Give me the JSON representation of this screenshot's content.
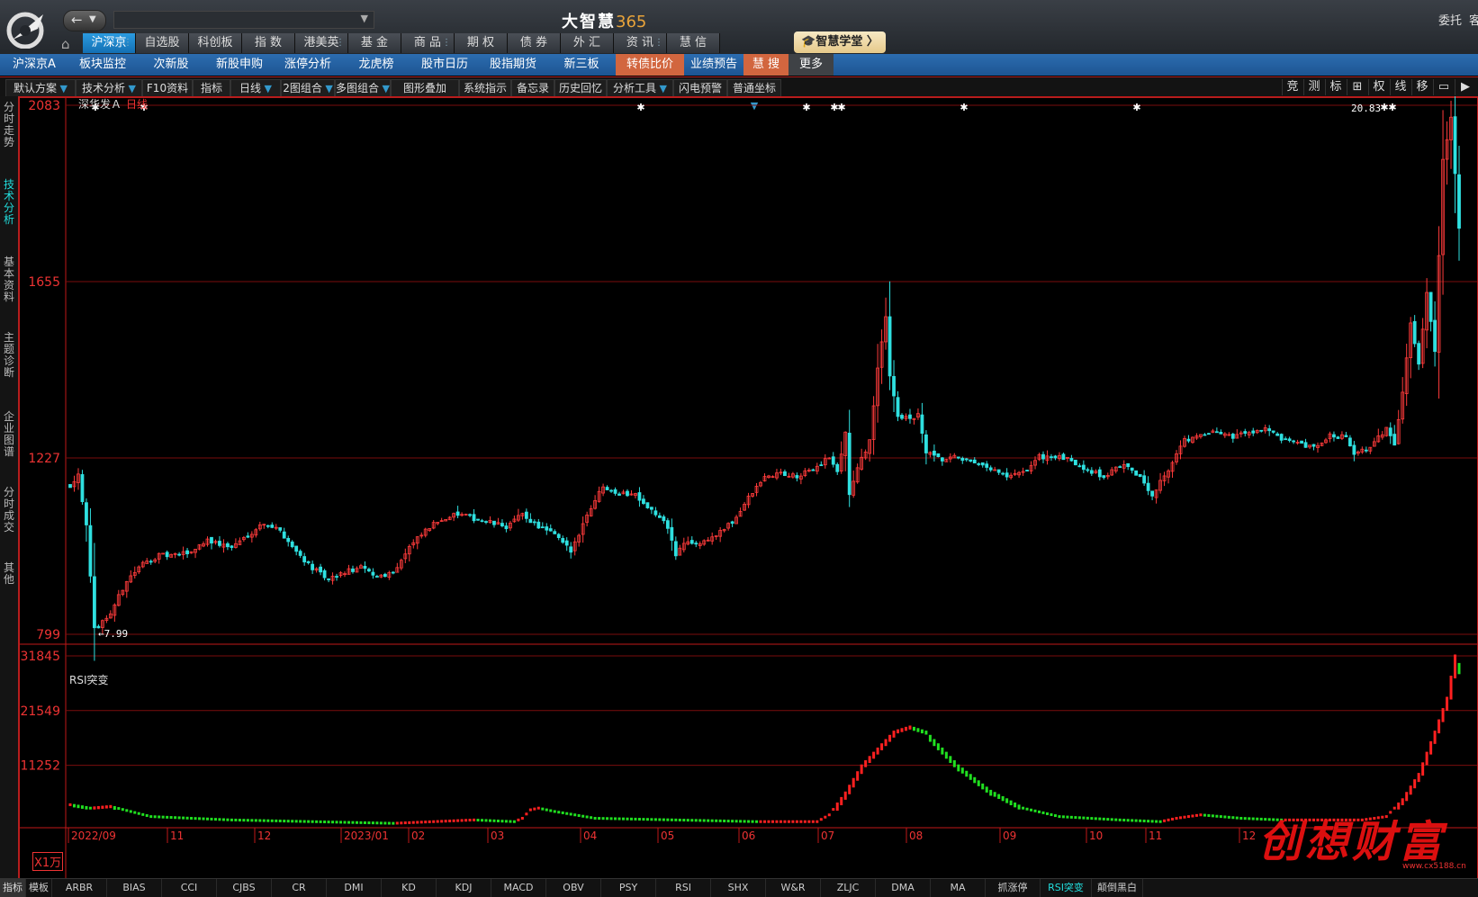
{
  "app": {
    "title_text": "大智慧",
    "title_num": "365",
    "entrust": "委托",
    "entrust2": "客"
  },
  "main_nav": [
    {
      "label": "沪深京",
      "active": true,
      "dots": true
    },
    {
      "label": "自选股",
      "active": false,
      "dots": false
    },
    {
      "label": "科创板",
      "active": false,
      "dots": false
    },
    {
      "label": "指 数",
      "active": false,
      "dots": false
    },
    {
      "label": "港美英",
      "active": false,
      "dots": true
    },
    {
      "label": "基 金",
      "active": false,
      "dots": false
    },
    {
      "label": "商 品",
      "active": false,
      "dots": true
    },
    {
      "label": "期 权",
      "active": false,
      "dots": false
    },
    {
      "label": "债 券",
      "active": false,
      "dots": false
    },
    {
      "label": "外 汇",
      "active": false,
      "dots": false
    },
    {
      "label": "资 讯",
      "active": false,
      "dots": true
    },
    {
      "label": "慧 信",
      "active": false,
      "dots": false
    }
  ],
  "academy_label": "智慧学堂",
  "menu2": [
    {
      "label": "沪深京A",
      "style": ""
    },
    {
      "label": "板块监控",
      "style": ""
    },
    {
      "label": "次新股",
      "style": ""
    },
    {
      "label": "新股申购",
      "style": ""
    },
    {
      "label": "涨停分析",
      "style": ""
    },
    {
      "label": "龙虎榜",
      "style": ""
    },
    {
      "label": "股市日历",
      "style": ""
    },
    {
      "label": "股指期货",
      "style": ""
    },
    {
      "label": "新三板",
      "style": ""
    },
    {
      "label": "转债比价",
      "style": "hot"
    },
    {
      "label": "业绩预告",
      "style": ""
    },
    {
      "label": "慧 搜",
      "style": "hot"
    },
    {
      "label": "更多",
      "style": "gray"
    }
  ],
  "toolbar": [
    {
      "label": "默认方案",
      "arrow": true
    },
    {
      "label": "技术分析",
      "arrow": true
    },
    {
      "label": "F10资料",
      "arrow": false
    },
    {
      "label": "指标",
      "arrow": false
    },
    {
      "label": "日线",
      "arrow": true
    },
    {
      "label": "2图组合",
      "arrow": true
    },
    {
      "label": "多图组合",
      "arrow": true
    },
    {
      "label": "图形叠加",
      "arrow": false
    },
    {
      "label": "系统指示",
      "arrow": false
    },
    {
      "label": "备忘录",
      "arrow": false
    },
    {
      "label": "历史回忆",
      "arrow": false
    },
    {
      "label": "分析工具",
      "arrow": true
    },
    {
      "label": "闪电预警",
      "arrow": false
    },
    {
      "label": "普通坐标",
      "arrow": true
    }
  ],
  "toolbar_right": [
    "竞",
    "测",
    "标",
    "⊞",
    "权",
    "线",
    "移",
    "▭",
    "▶"
  ],
  "left_tabs": [
    {
      "label": "分时走势",
      "active": false
    },
    {
      "label": "技术分析",
      "active": true
    },
    {
      "label": "基本资料",
      "active": false
    },
    {
      "label": "主题诊断",
      "active": false
    },
    {
      "label": "企业图谱",
      "active": false
    },
    {
      "label": "分时成交",
      "active": false
    },
    {
      "label": "其他",
      "active": false
    }
  ],
  "stock": {
    "name": "深华发Ａ",
    "period": "日线"
  },
  "chart_data": {
    "type": "candlestick",
    "price_axis": {
      "labels": [
        "2083",
        "1655",
        "1227",
        "799"
      ],
      "values": [
        20.83,
        16.55,
        12.27,
        7.99
      ]
    },
    "max_label": "20.83",
    "min_label": "7.99",
    "indicator": {
      "name": "RSI突变",
      "axis_labels": [
        "31845",
        "21549",
        "11252"
      ],
      "axis_values": [
        31845,
        21549,
        11252
      ],
      "unit_label": "X1万"
    },
    "x_labels": [
      "2022/09",
      "11",
      "12",
      "2023/01",
      "02",
      "03",
      "04",
      "05",
      "06",
      "07",
      "08",
      "09",
      "10",
      "11",
      "12"
    ],
    "price_anchors": [
      [
        0,
        11.6
      ],
      [
        2,
        11.9
      ],
      [
        4,
        10.6
      ],
      [
        6,
        8.1
      ],
      [
        10,
        8.5
      ],
      [
        14,
        9.3
      ],
      [
        18,
        9.7
      ],
      [
        22,
        9.9
      ],
      [
        26,
        9.9
      ],
      [
        30,
        10.0
      ],
      [
        34,
        10.3
      ],
      [
        36,
        10.2
      ],
      [
        40,
        10.1
      ],
      [
        44,
        10.4
      ],
      [
        48,
        10.7
      ],
      [
        52,
        10.5
      ],
      [
        56,
        10.0
      ],
      [
        60,
        9.6
      ],
      [
        64,
        9.3
      ],
      [
        68,
        9.5
      ],
      [
        72,
        9.6
      ],
      [
        76,
        9.4
      ],
      [
        80,
        9.5
      ],
      [
        84,
        10.1
      ],
      [
        88,
        10.5
      ],
      [
        92,
        10.8
      ],
      [
        96,
        10.9
      ],
      [
        100,
        10.8
      ],
      [
        104,
        10.7
      ],
      [
        108,
        10.6
      ],
      [
        112,
        10.9
      ],
      [
        116,
        10.6
      ],
      [
        120,
        10.4
      ],
      [
        124,
        10.0
      ],
      [
        128,
        10.9
      ],
      [
        132,
        11.6
      ],
      [
        136,
        11.4
      ],
      [
        140,
        11.4
      ],
      [
        144,
        11.0
      ],
      [
        148,
        10.6
      ],
      [
        150,
        9.9
      ],
      [
        152,
        10.2
      ],
      [
        156,
        10.2
      ],
      [
        160,
        10.4
      ],
      [
        164,
        10.7
      ],
      [
        168,
        11.3
      ],
      [
        172,
        11.8
      ],
      [
        176,
        11.9
      ],
      [
        180,
        11.8
      ],
      [
        184,
        12.0
      ],
      [
        188,
        12.3
      ],
      [
        190,
        11.9
      ],
      [
        192,
        12.9
      ],
      [
        193,
        11.4
      ],
      [
        195,
        12.0
      ],
      [
        198,
        12.7
      ],
      [
        200,
        14.4
      ],
      [
        202,
        15.7
      ],
      [
        203,
        14.3
      ],
      [
        205,
        13.3
      ],
      [
        208,
        13.2
      ],
      [
        210,
        13.3
      ],
      [
        212,
        12.4
      ],
      [
        216,
        12.2
      ],
      [
        220,
        12.3
      ],
      [
        224,
        12.1
      ],
      [
        228,
        12.0
      ],
      [
        232,
        11.8
      ],
      [
        236,
        11.9
      ],
      [
        240,
        12.3
      ],
      [
        244,
        12.3
      ],
      [
        248,
        12.2
      ],
      [
        252,
        12.0
      ],
      [
        256,
        11.8
      ],
      [
        260,
        12.1
      ],
      [
        264,
        11.9
      ],
      [
        268,
        11.4
      ],
      [
        272,
        12.0
      ],
      [
        276,
        12.7
      ],
      [
        280,
        12.8
      ],
      [
        284,
        12.9
      ],
      [
        288,
        12.8
      ],
      [
        292,
        12.9
      ],
      [
        296,
        13.0
      ],
      [
        300,
        12.7
      ],
      [
        304,
        12.6
      ],
      [
        308,
        12.5
      ],
      [
        312,
        12.8
      ],
      [
        316,
        12.8
      ],
      [
        318,
        12.4
      ],
      [
        322,
        12.5
      ],
      [
        326,
        13.0
      ],
      [
        328,
        12.6
      ],
      [
        330,
        13.9
      ],
      [
        332,
        15.6
      ],
      [
        334,
        14.5
      ],
      [
        336,
        16.3
      ],
      [
        338,
        14.9
      ],
      [
        340,
        19.5
      ],
      [
        342,
        20.6
      ],
      [
        344,
        17.8
      ]
    ],
    "rsi_anchors": [
      [
        0,
        0.12
      ],
      [
        5,
        0.1
      ],
      [
        10,
        0.11
      ],
      [
        20,
        0.05
      ],
      [
        40,
        0.03
      ],
      [
        60,
        0.02
      ],
      [
        80,
        0.01
      ],
      [
        100,
        0.03
      ],
      [
        110,
        0.02
      ],
      [
        112,
        0.04
      ],
      [
        114,
        0.09
      ],
      [
        116,
        0.1
      ],
      [
        120,
        0.08
      ],
      [
        130,
        0.04
      ],
      [
        150,
        0.03
      ],
      [
        170,
        0.02
      ],
      [
        185,
        0.02
      ],
      [
        188,
        0.06
      ],
      [
        192,
        0.19
      ],
      [
        196,
        0.35
      ],
      [
        200,
        0.45
      ],
      [
        204,
        0.55
      ],
      [
        208,
        0.58
      ],
      [
        212,
        0.55
      ],
      [
        216,
        0.45
      ],
      [
        220,
        0.35
      ],
      [
        228,
        0.2
      ],
      [
        236,
        0.1
      ],
      [
        245,
        0.05
      ],
      [
        260,
        0.03
      ],
      [
        270,
        0.02
      ],
      [
        274,
        0.04
      ],
      [
        280,
        0.06
      ],
      [
        290,
        0.04
      ],
      [
        300,
        0.03
      ],
      [
        320,
        0.03
      ],
      [
        326,
        0.05
      ],
      [
        330,
        0.15
      ],
      [
        334,
        0.3
      ],
      [
        338,
        0.55
      ],
      [
        341,
        0.75
      ],
      [
        343,
        1.0
      ],
      [
        344,
        0.95
      ]
    ]
  },
  "bottom_tabs": [
    {
      "label": "指标",
      "style": "first"
    },
    {
      "label": "模板",
      "style": ""
    },
    {
      "label": "ARBR",
      "style": ""
    },
    {
      "label": "BIAS",
      "style": ""
    },
    {
      "label": "CCI",
      "style": ""
    },
    {
      "label": "CJBS",
      "style": ""
    },
    {
      "label": "CR",
      "style": ""
    },
    {
      "label": "DMI",
      "style": ""
    },
    {
      "label": "KD",
      "style": ""
    },
    {
      "label": "KDJ",
      "style": ""
    },
    {
      "label": "MACD",
      "style": ""
    },
    {
      "label": "OBV",
      "style": ""
    },
    {
      "label": "PSY",
      "style": ""
    },
    {
      "label": "RSI",
      "style": ""
    },
    {
      "label": "SHX",
      "style": ""
    },
    {
      "label": "W&R",
      "style": ""
    },
    {
      "label": "ZLJC",
      "style": ""
    },
    {
      "label": "DMA",
      "style": ""
    },
    {
      "label": "MA",
      "style": ""
    },
    {
      "label": "抓涨停",
      "style": ""
    },
    {
      "label": "RSI突变",
      "style": "active"
    },
    {
      "label": "颠倒黑白",
      "style": ""
    }
  ],
  "watermark": "创想财富",
  "watermark_sub": "www.cx5188.cn",
  "colors": {
    "up": "#ff3b3b",
    "down": "#2fe0e0",
    "grid": "#7a0d0d",
    "axis": "#c01818",
    "rsi_up": "#ff2020",
    "rsi_down": "#20e020"
  }
}
